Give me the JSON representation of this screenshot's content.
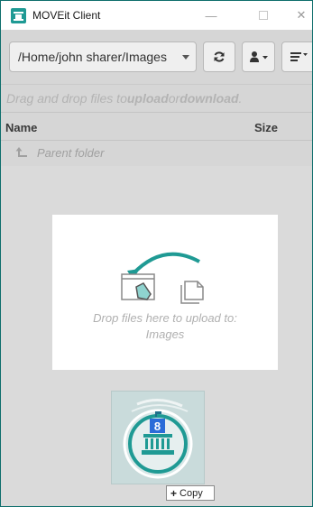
{
  "window": {
    "title": "MOVEit Client",
    "minimize_glyph": "—",
    "close_glyph": "✕"
  },
  "toolbar": {
    "path": "/Home/john sharer/Images",
    "refresh_icon": "refresh-icon",
    "user_icon": "user-dropdown-icon",
    "menu_icon": "menu-dropdown-icon"
  },
  "hint": {
    "prefix": "Drag and drop files to ",
    "upload": "upload",
    "middle": " or ",
    "download": "download",
    "suffix": "."
  },
  "columns": {
    "name": "Name",
    "size": "Size"
  },
  "parent_folder": {
    "label": "Parent folder"
  },
  "drop_zone": {
    "line1": "Drop files here to upload to:",
    "line2": "Images"
  },
  "drag": {
    "badge_number": "8",
    "tooltip_plus": "+",
    "tooltip_label": "Copy"
  },
  "colors": {
    "accent": "#1f9a94",
    "background": "#d6d6d6",
    "drop_zone": "#ffffff"
  }
}
